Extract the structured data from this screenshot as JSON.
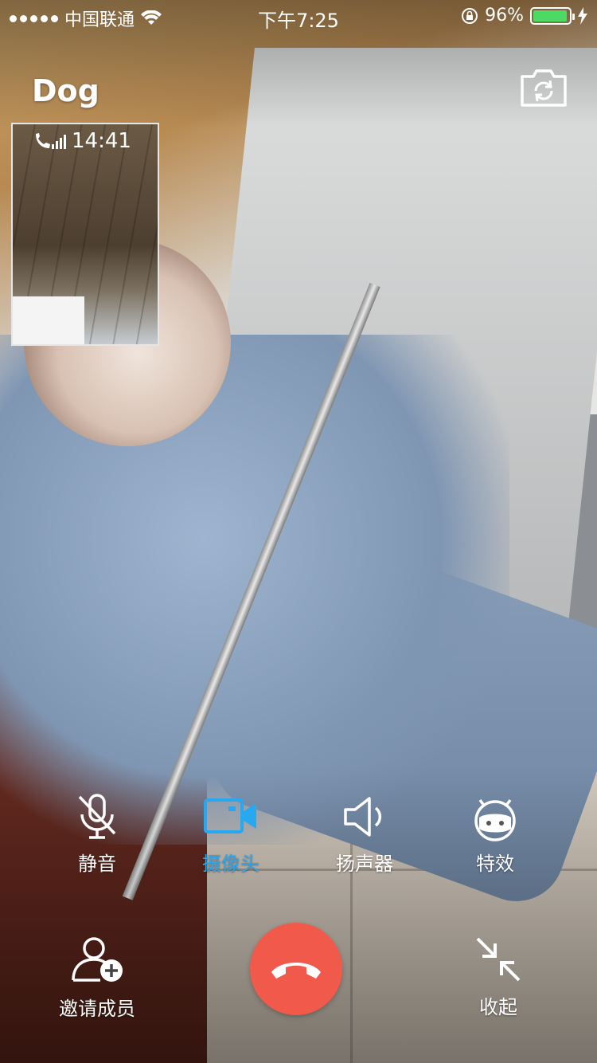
{
  "status_bar": {
    "carrier": "中国联通",
    "time": "下午7:25",
    "battery_percent": "96%",
    "battery_level": 0.96,
    "battery_color": "#4cd964"
  },
  "call": {
    "contact_name": "Dog",
    "pip_time": "14:41"
  },
  "controls": {
    "mute": {
      "label": "静音",
      "icon": "mic-muted-icon"
    },
    "camera": {
      "label": "摄像头",
      "icon": "video-camera-icon",
      "active": true,
      "active_color": "#29a8f2"
    },
    "speaker": {
      "label": "扬声器",
      "icon": "speaker-icon"
    },
    "effects": {
      "label": "特效",
      "icon": "robot-face-icon"
    },
    "invite": {
      "label": "邀请成员",
      "icon": "add-user-icon"
    },
    "hangup": {
      "icon": "hang-up-icon",
      "color": "#f15a4a"
    },
    "minimize": {
      "label": "收起",
      "icon": "minimize-arrows-icon"
    }
  },
  "header": {
    "switch_camera_icon": "switch-camera-icon"
  }
}
